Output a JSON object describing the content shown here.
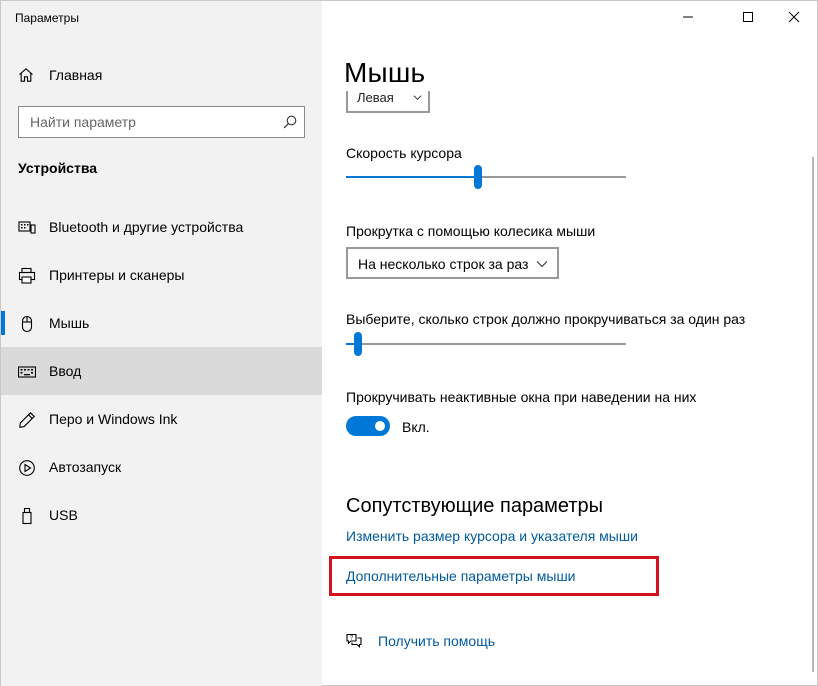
{
  "window": {
    "title": "Параметры",
    "controls": {
      "minimize_icon": "minimize-icon",
      "maximize_icon": "maximize-icon",
      "close_icon": "close-icon"
    }
  },
  "sidebar": {
    "home_label": "Главная",
    "search_placeholder": "Найти параметр",
    "section_title": "Устройства",
    "items": [
      {
        "label": "Bluetooth и другие устройства",
        "icon": "bluetooth-devices-icon"
      },
      {
        "label": "Принтеры и сканеры",
        "icon": "printer-icon"
      },
      {
        "label": "Мышь",
        "icon": "mouse-icon"
      },
      {
        "label": "Ввод",
        "icon": "keyboard-icon"
      },
      {
        "label": "Перо и Windows Ink",
        "icon": "pen-icon"
      },
      {
        "label": "Автозапуск",
        "icon": "autoplay-icon"
      },
      {
        "label": "USB",
        "icon": "usb-icon"
      }
    ],
    "selected_index": 2,
    "hover_index": 3
  },
  "main": {
    "title": "Мышь",
    "primary_button_value": "Левая",
    "cursor_speed": {
      "label": "Скорость курсора",
      "value": 0.47
    },
    "scroll_mode": {
      "label": "Прокрутка с помощью колесика мыши",
      "value": "На несколько строк за раз"
    },
    "lines_to_scroll": {
      "label": "Выберите, сколько строк должно прокручиваться за один раз",
      "value": 0.03
    },
    "inactive_scroll": {
      "label": "Прокручивать неактивные окна при наведении на них",
      "state_label": "Вкл.",
      "on": true
    },
    "related": {
      "title": "Сопутствующие параметры",
      "links": [
        "Изменить размер курсора и указателя мыши",
        "Дополнительные параметры мыши"
      ],
      "highlighted_link_index": 1
    },
    "help_label": "Получить помощь"
  },
  "colors": {
    "accent": "#0078d7",
    "link": "#005a9e",
    "highlight_border": "#d6101d",
    "sidebar_bg": "#f2f2f2"
  }
}
